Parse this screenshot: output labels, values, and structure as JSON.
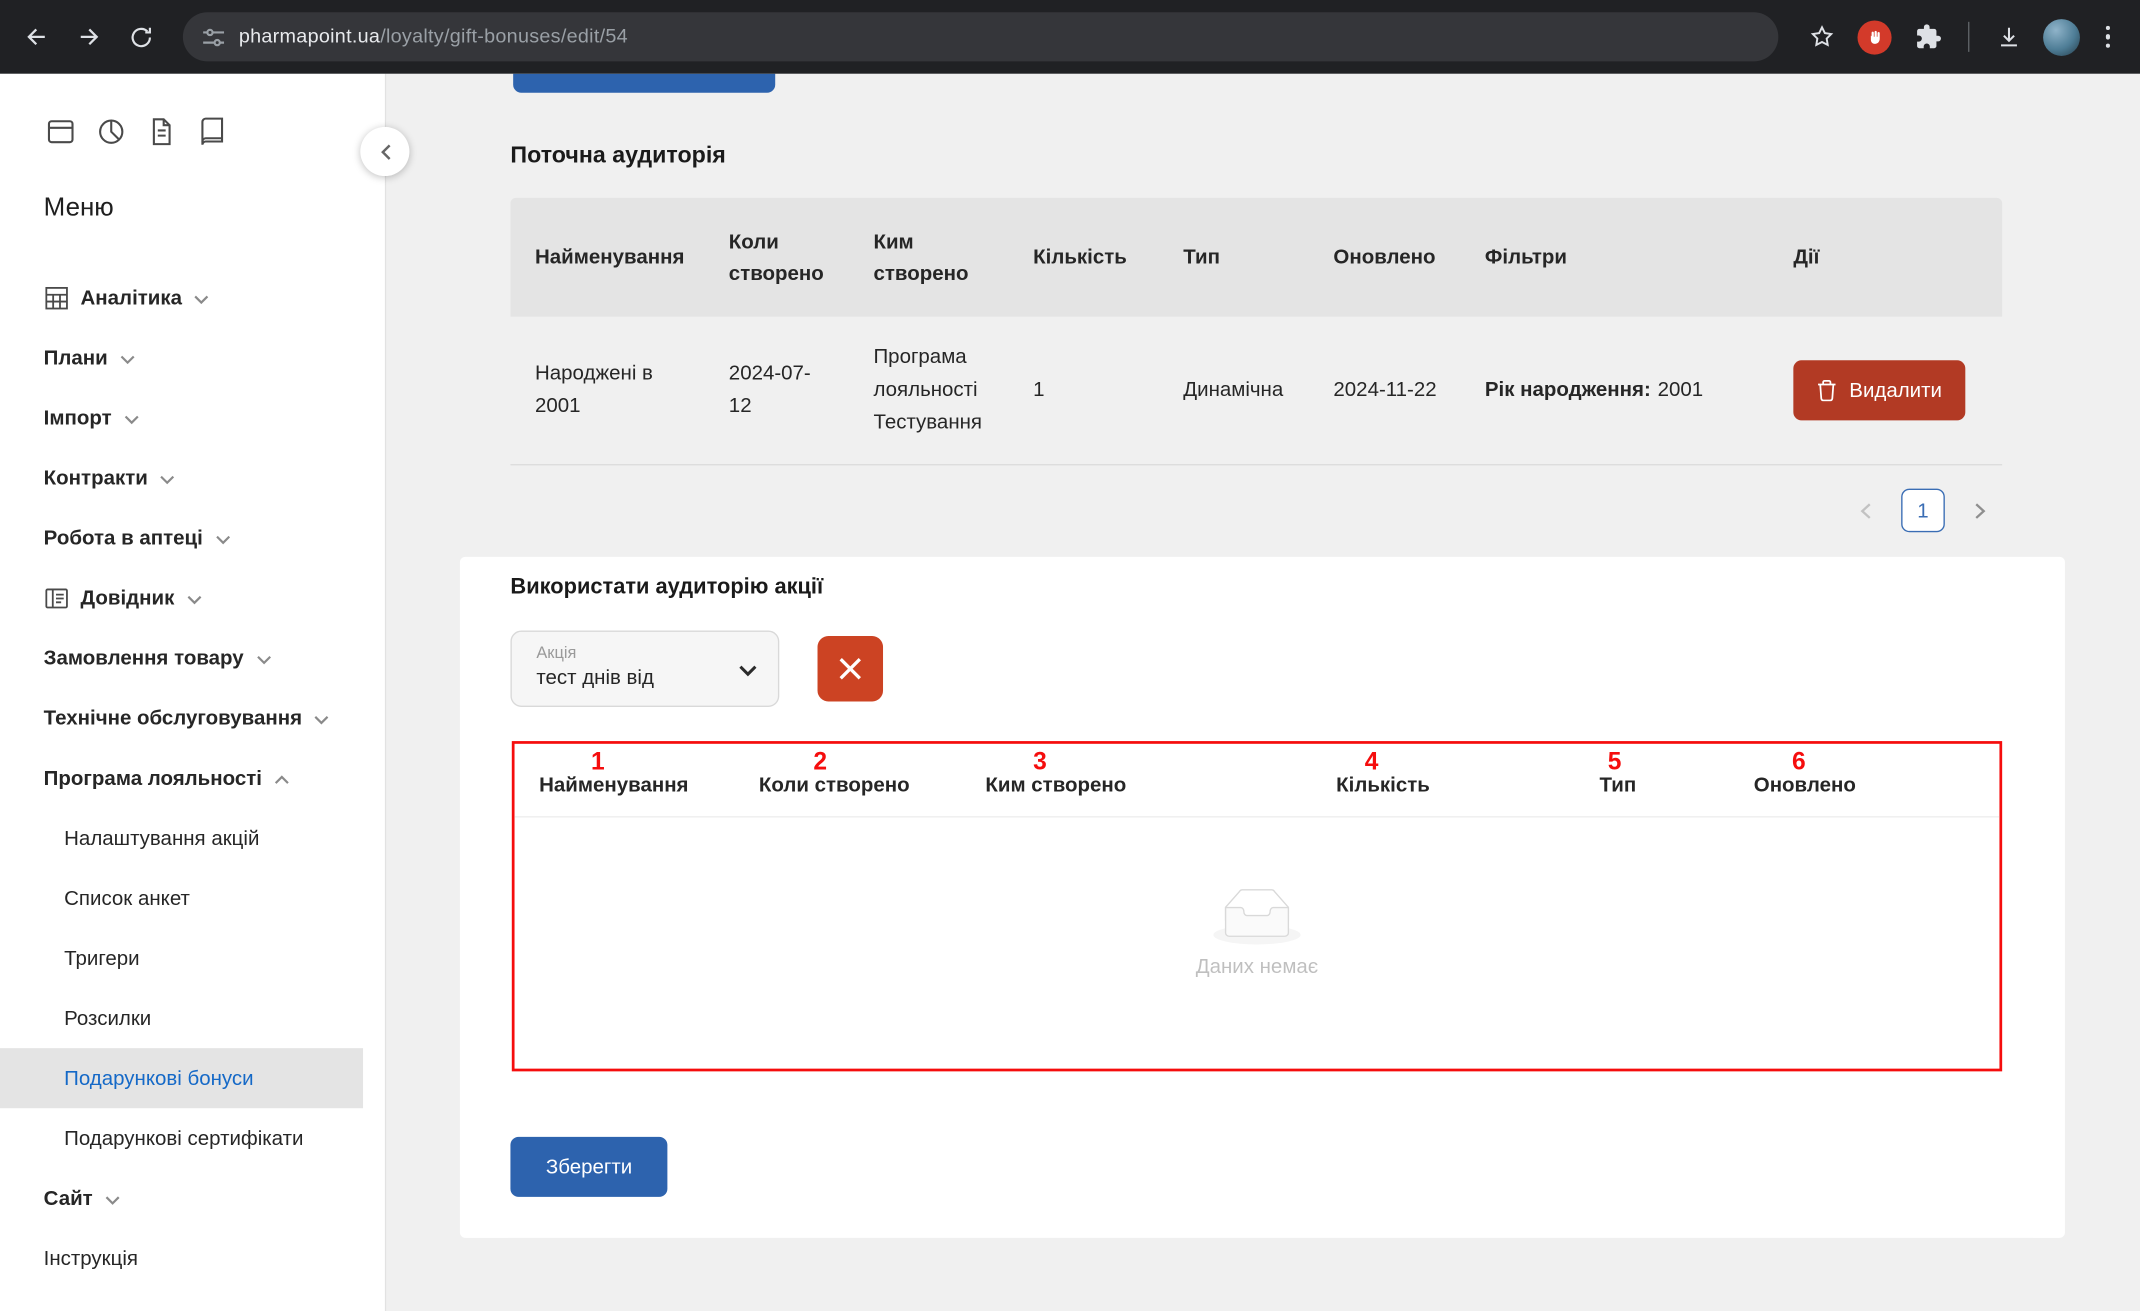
{
  "browser": {
    "url_domain": "pharmapoint.ua",
    "url_path": "/loyalty/gift-bonuses/edit/54"
  },
  "sidebar": {
    "menu_title": "Меню",
    "items": [
      "Аналітика",
      "Плани",
      "Імпорт",
      "Контракти",
      "Робота в аптеці",
      "Довідник",
      "Замовлення товару",
      "Технічне обслуговування",
      "Програма лояльності"
    ],
    "loyalty_subitems": [
      "Налаштування акцій",
      "Список анкет",
      "Тригери",
      "Розсилки",
      "Подарункові бонуси",
      "Подарункові сертифікати"
    ],
    "footer_items": [
      "Сайт",
      "Інструкція"
    ]
  },
  "current_audience": {
    "title": "Поточна аудиторія",
    "columns": [
      "Найменування",
      "Коли створено",
      "Ким створено",
      "Кількість",
      "Тип",
      "Оновлено",
      "Фільтри",
      "Дії"
    ],
    "row": {
      "name": "Народжені в 2001",
      "created_at": "2024-07-12",
      "created_by": "Програма лояльності Тестування",
      "quantity": "1",
      "type": "Динамічна",
      "updated_at": "2024-11-22",
      "filter_label": "Рік народження:",
      "filter_value": "2001",
      "delete_button": "Видалити"
    },
    "pagination": {
      "current_page": "1"
    }
  },
  "promo_audience": {
    "title": "Використати аудиторію акції",
    "promo_select": {
      "label": "Акція",
      "value": "тест днів від"
    },
    "columns": [
      "Найменування",
      "Коли створено",
      "Ким створено",
      "Кількість",
      "Тип",
      "Оновлено"
    ],
    "empty_text": "Даних немає",
    "save_button": "Зберегти"
  },
  "annotations": {
    "numbers": [
      "1",
      "2",
      "3",
      "4",
      "5",
      "6"
    ]
  },
  "colors": {
    "primary_blue": "#2d63ae",
    "danger_red": "#b23a24",
    "active_link_blue": "#1569c7",
    "annotation_red": "#f50d0d"
  }
}
